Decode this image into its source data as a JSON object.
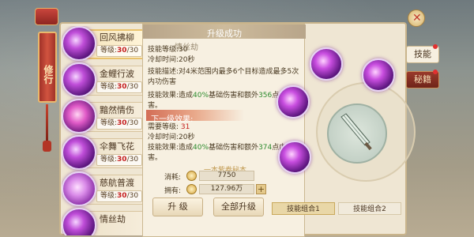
{
  "banner": {
    "label": "修行"
  },
  "skills": [
    {
      "name": "回风拂柳",
      "level_label": "等级:",
      "level": "30",
      "max": "/30",
      "selected": true
    },
    {
      "name": "金鲤行波",
      "level_label": "等级:",
      "level": "30",
      "max": "/30",
      "selected": false
    },
    {
      "name": "黯然情伤",
      "level_label": "等级:",
      "level": "30",
      "max": "/30",
      "selected": false
    },
    {
      "name": "伞舞飞花",
      "level_label": "等级:",
      "level": "30",
      "max": "/30",
      "selected": false
    },
    {
      "name": "慈航普渡",
      "level_label": "等级:",
      "level": "30",
      "max": "/30",
      "selected": false
    },
    {
      "name": "情丝劫",
      "level_label": "",
      "level": "",
      "max": "",
      "selected": false
    }
  ],
  "popup": {
    "header": "升级成功",
    "ghost_title": "情丝劫",
    "skill_level": "技能等级:30",
    "cooldown": "冷却时间:20秒",
    "desc": "技能描述:对4米范围内最多6个目标造成最多5次内功伤害",
    "effect_prefix": "技能效果:造成",
    "effect_pct": "40%",
    "effect_mid": "基础伤害和额外",
    "effect_val": "356",
    "effect_suffix": "点内功伤害。",
    "next_header": "下一级效果:",
    "need_level_label": "需要等级:",
    "need_level": "31",
    "next_cooldown": "冷却时间:20秒",
    "next_effect_prefix": "技能效果:造成",
    "next_effect_pct": "40%",
    "next_effect_mid": "基础伤害和额外",
    "next_effect_val": "374",
    "next_effect_suffix": "点内功伤害。"
  },
  "cost": {
    "book_label": "一本紫卷秘本",
    "consume_label": "消耗:",
    "consume_value": "7750",
    "own_label": "拥有:",
    "own_value": "127.96万",
    "plus": "+"
  },
  "buttons": {
    "upgrade": "升 级",
    "upgrade_all": "全部升级"
  },
  "side_tabs": {
    "skill": "技能",
    "secret": "秘籍"
  },
  "combos": {
    "combo1": "技能组合1",
    "combo2": "技能组合2"
  },
  "close_icon": "✕"
}
